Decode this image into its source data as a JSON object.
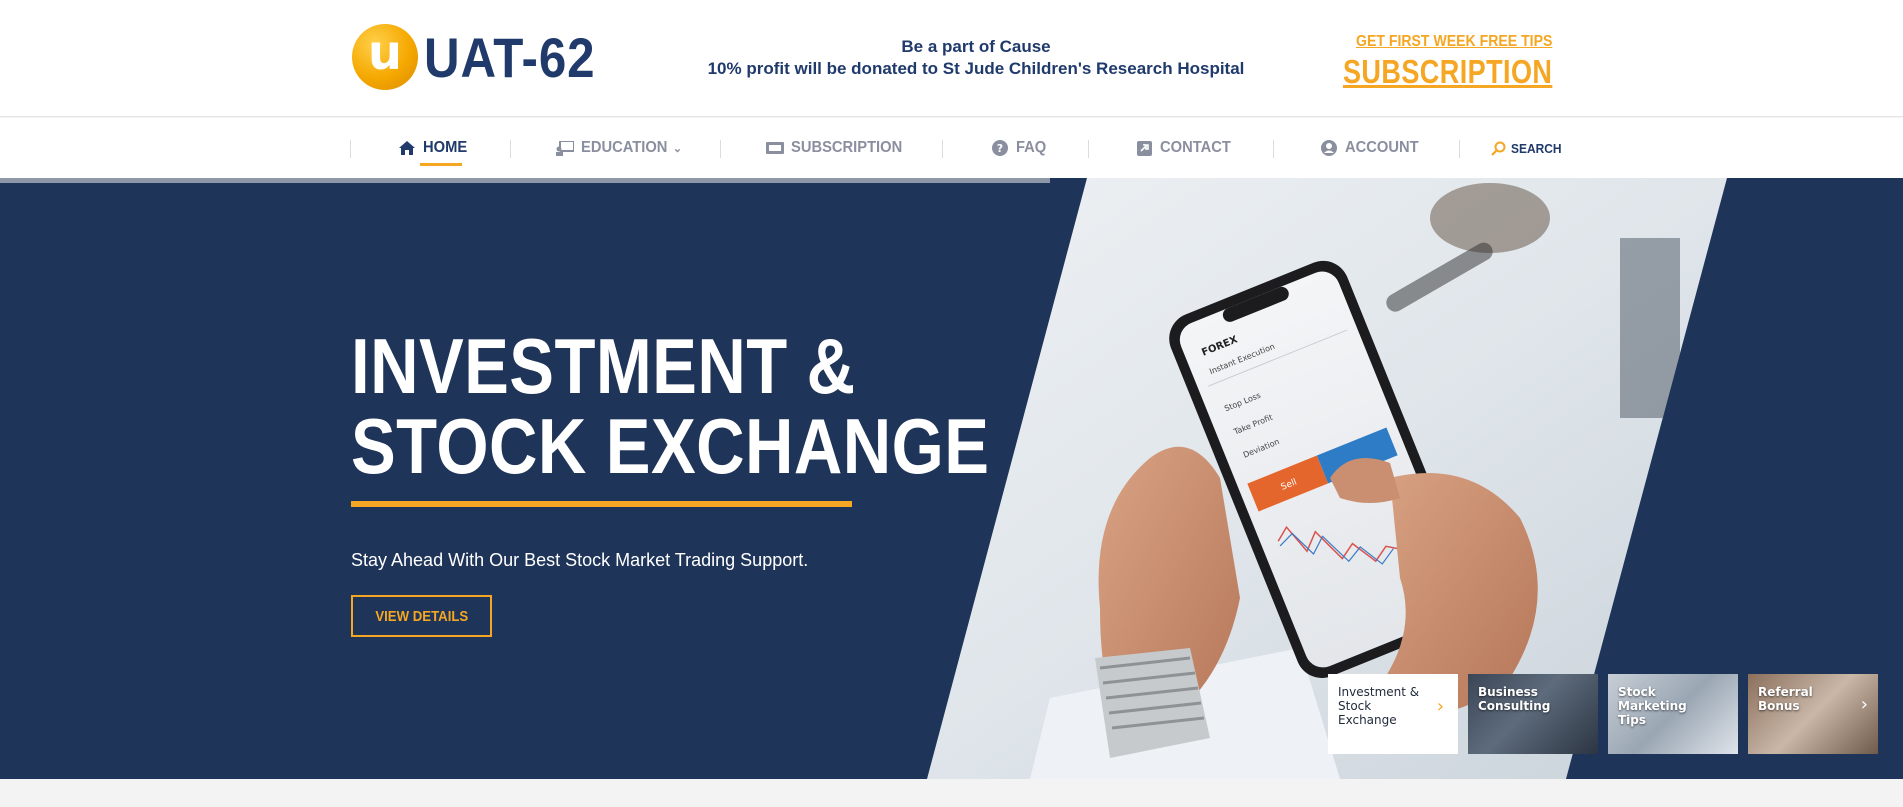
{
  "header": {
    "logo_letter": "u",
    "logo_text": "UAT-62",
    "cause_line1": "Be a part of Cause",
    "cause_line2": "10% profit will be donated to St Jude Children's Research Hospital",
    "promo_small": "GET FIRST WEEK FREE TIPS",
    "promo_big": "SUBSCRIPTION"
  },
  "nav": {
    "items": [
      {
        "label": "HOME",
        "icon": "home-icon"
      },
      {
        "label": "EDUCATION",
        "icon": "education-icon"
      },
      {
        "label": "SUBSCRIPTION",
        "icon": "ticket-icon"
      },
      {
        "label": "FAQ",
        "icon": "question-circle-icon"
      },
      {
        "label": "CONTACT",
        "icon": "contact-card-icon"
      },
      {
        "label": "ACCOUNT",
        "icon": "user-circle-icon"
      }
    ],
    "search_label": "SEARCH"
  },
  "hero": {
    "title_line1": "INVESTMENT &",
    "title_line2": "STOCK EXCHANGE",
    "subtitle": "Stay Ahead With Our Best Stock Market Trading Support.",
    "button": "VIEW DETAILS",
    "phone": {
      "header": "FOREX",
      "execution": "Instant Execution",
      "stop_loss": "Stop Loss",
      "take_profit": "Take Profit",
      "deviation": "Deviation",
      "sell": "Sell"
    }
  },
  "slides": [
    {
      "label": "Investment & Stock Exchange"
    },
    {
      "label": "Business Consulting"
    },
    {
      "label": "Stock Marketing Tips"
    },
    {
      "label": "Referral Bonus"
    }
  ],
  "colors": {
    "navy": "#1f3459",
    "brand_blue": "#1f3a6b",
    "accent": "#f5a623",
    "nav_grey": "#8a8fa0"
  }
}
